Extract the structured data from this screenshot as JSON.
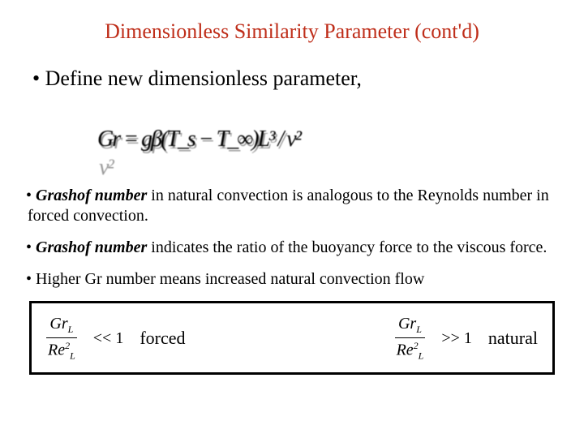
{
  "title": "Dimensionless Similarity Parameter (cont'd)",
  "lead_bullet": "Define new dimensionless parameter,",
  "formula_display": "Gr = gβ(T_s − T_∞)L³ / ν²",
  "para1_prefix": "Grashof number",
  "para1_rest": " in natural convection is analogous to the Reynolds number in forced convection.",
  "para2_prefix": "Grashof number",
  "para2_rest": " indicates the ratio of the buoyancy force to the viscous force.",
  "para3": "Higher Gr number means increased natural convection flow",
  "box": {
    "left": {
      "frac_num_main": "Gr",
      "frac_num_sub": "L",
      "frac_den_main": "Re",
      "frac_den_sub": "L",
      "frac_den_sup": "2",
      "comparator": "<< 1",
      "label": "forced"
    },
    "right": {
      "frac_num_main": "Gr",
      "frac_num_sub": "L",
      "frac_den_main": "Re",
      "frac_den_sub": "L",
      "frac_den_sup": "2",
      "comparator": ">> 1",
      "label": "natural"
    }
  }
}
